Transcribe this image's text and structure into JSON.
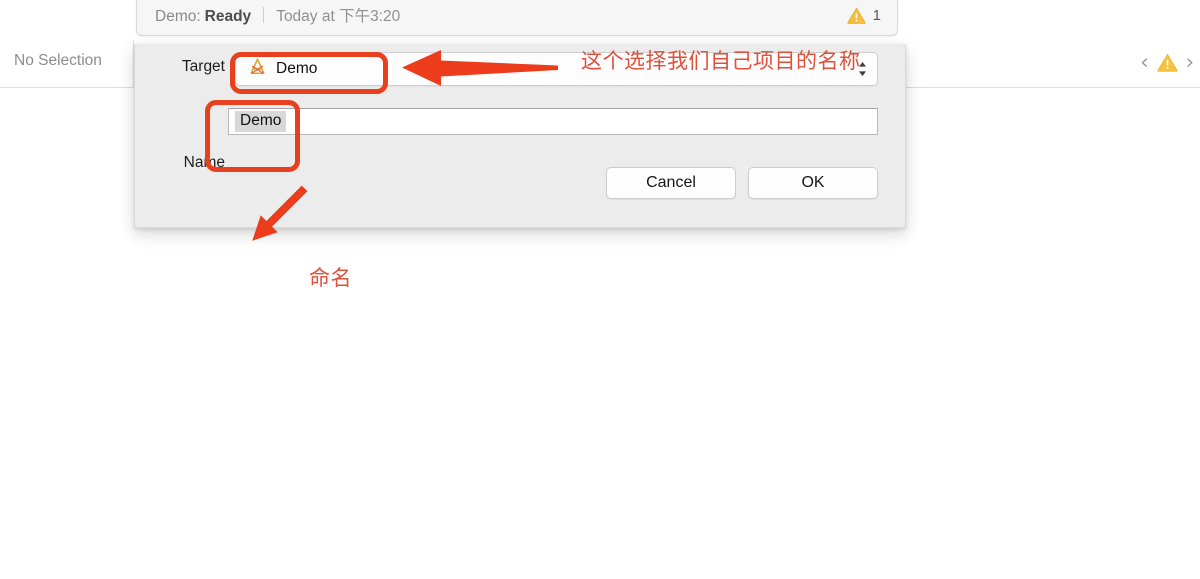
{
  "status_bar": {
    "scheme": "Demo:",
    "state": "Ready",
    "time": "Today at 下午3:20",
    "warning_icon": "warning-triangle-icon",
    "warning_count": "1"
  },
  "selection_bar": {
    "selection_label": "No Selection",
    "prev_icon": "chevron-left-icon",
    "warning_icon": "warning-triangle-icon",
    "next_icon": "chevron-right-icon"
  },
  "dialog": {
    "target": {
      "label": "Target",
      "app_icon": "xcode-app-target-icon",
      "value": "Demo",
      "stepper_icon": "stepper-updown-icon"
    },
    "name": {
      "label": "Name",
      "value": "Demo"
    },
    "buttons": {
      "cancel": "Cancel",
      "ok": "OK"
    }
  },
  "annotations": {
    "target_note": "这个选择我们自己项目的名称",
    "name_note": "命名",
    "arrow_target": "red-left-arrow",
    "arrow_name": "red-diagonal-arrow",
    "box_target": "red-highlight-box",
    "box_name": "red-highlight-box",
    "color": "#e8401f"
  }
}
